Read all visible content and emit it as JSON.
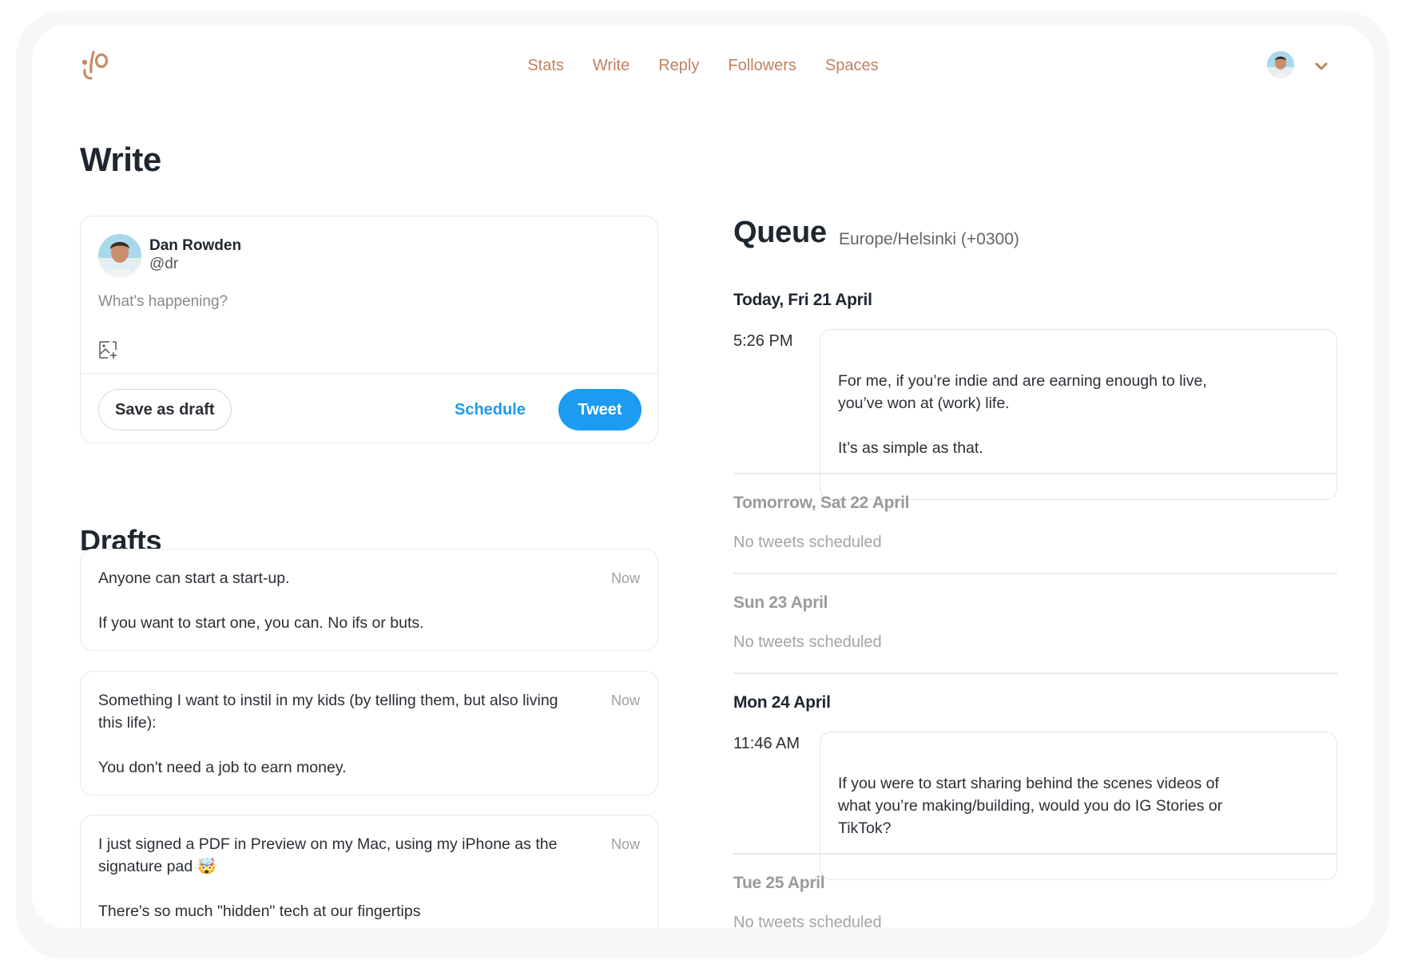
{
  "nav": {
    "items": [
      {
        "label": "Stats"
      },
      {
        "label": "Write"
      },
      {
        "label": "Reply"
      },
      {
        "label": "Followers"
      },
      {
        "label": "Spaces"
      }
    ],
    "accent_color": "#c1825e"
  },
  "page": {
    "title": "Write"
  },
  "compose": {
    "user_name": "Dan Rowden",
    "user_handle": "@dr",
    "placeholder": "What's happening?",
    "value": "",
    "save_draft_label": "Save as draft",
    "schedule_label": "Schedule",
    "tweet_label": "Tweet",
    "tweet_color": "#1d9bf0"
  },
  "drafts": {
    "title": "Drafts",
    "items": [
      {
        "text": "Anyone can start a start-up.\n\nIf you want to start one, you can. No ifs or buts.",
        "time": "Now"
      },
      {
        "text": "Something I want to instil in my kids (by telling them, but also living this life):\n\nYou don't need a job to earn money.",
        "time": "Now"
      },
      {
        "text": "I just signed a PDF in Preview on my Mac, using my iPhone as the signature pad 🤯\n\nThere's so much \"hidden\" tech at our fingertips",
        "time": "Now"
      }
    ]
  },
  "queue": {
    "title": "Queue",
    "timezone": "Europe/Helsinki (+0300)",
    "days": [
      {
        "label": "Today, Fri 21 April",
        "slots": [
          {
            "time": "5:26 PM",
            "text": "For me, if you’re indie and are earning enough to live, you’ve won at (work) life.\n\nIt’s as simple as that."
          }
        ]
      },
      {
        "label": "Tomorrow, Sat 22 April",
        "empty_text": "No tweets scheduled"
      },
      {
        "label": "Sun 23 April",
        "empty_text": "No tweets scheduled"
      },
      {
        "label": "Mon 24 April",
        "slots": [
          {
            "time": "11:46 AM",
            "text": "If you were to start sharing behind the scenes videos of what you’re making/building, would you do IG Stories or TikTok?"
          }
        ]
      },
      {
        "label": "Tue 25 April",
        "empty_text": "No tweets scheduled"
      }
    ]
  }
}
